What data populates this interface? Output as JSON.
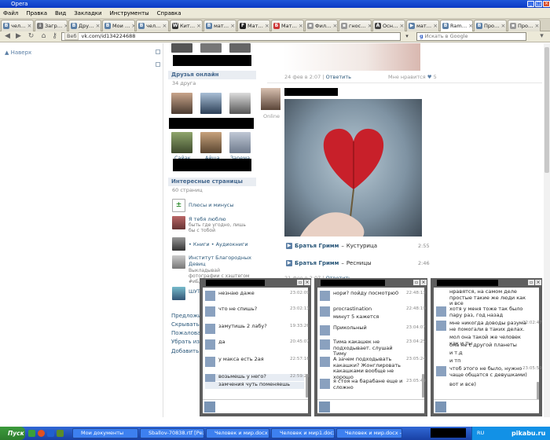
{
  "window": {
    "title": "Opera"
  },
  "menu": [
    "Файл",
    "Правка",
    "Вид",
    "Закладки",
    "Инструменты",
    "Справка"
  ],
  "tabs": [
    {
      "label": "чел…",
      "icon": "vk-icon",
      "color": "#5b7fa6"
    },
    {
      "label": "Загр…",
      "icon": "download-icon",
      "color": "#777777"
    },
    {
      "label": "Дру…",
      "icon": "vk-icon",
      "color": "#5b7fa6"
    },
    {
      "label": "Мои …",
      "icon": "vk-icon",
      "color": "#5b7fa6"
    },
    {
      "label": "чел…",
      "icon": "vk-icon",
      "color": "#5b7fa6"
    },
    {
      "label": "Кит…",
      "icon": "wikipedia-icon",
      "color": "#333333"
    },
    {
      "label": "мат…",
      "icon": "vk-icon",
      "color": "#5b7fa6"
    },
    {
      "label": "Мат…",
      "icon": "fb-icon",
      "color": "#222222"
    },
    {
      "label": "Мат…",
      "icon": "logo-icon",
      "color": "#cc3333"
    },
    {
      "label": "Фил…",
      "icon": "page-icon",
      "color": "#999999"
    },
    {
      "label": "гнос…",
      "icon": "page-icon",
      "color": "#999999"
    },
    {
      "label": "Осн…",
      "icon": "a-icon",
      "color": "#444444"
    },
    {
      "label": "мат…",
      "icon": "play-icon",
      "color": "#5b7fa6"
    },
    {
      "label": "Ram…",
      "icon": "vk-icon",
      "color": "#5b7fa6"
    },
    {
      "label": "Про…",
      "icon": "vk-icon",
      "color": "#5b7fa6"
    },
    {
      "label": "Про…",
      "icon": "page-icon",
      "color": "#999999"
    }
  ],
  "address": {
    "badge": "Веб",
    "url": "vk.com/id134224688",
    "search_placeholder": "Искать в Google"
  },
  "left": {
    "back": "Наверх"
  },
  "sidebar": {
    "friends_online_title": "Друзья онлайн",
    "friends_online_count": "34 друга",
    "friend_names": [
      "Сайак",
      "Айша",
      "Зарема"
    ],
    "pages_title": "Интересные страницы",
    "pages_count": "60 страниц",
    "pages": [
      {
        "name": "Плюсы и минусы",
        "desc": ""
      },
      {
        "name": "Я тебя люблю",
        "desc": "быть где угодно, лишь бы с тобой"
      },
      {
        "name": "• Книги • Аудиокниги",
        "desc": ""
      },
      {
        "name": "Институт Благородных Девиц",
        "desc": "Выкладывай фотографии с хэштегом #иБд . #bd - попадай в..."
      },
      {
        "name": "ШУТК…",
        "desc": ""
      }
    ],
    "links": [
      "Предложи…",
      "Скрывать но…",
      "Пожаловат…",
      "Убрать из др…",
      "Добавить в …"
    ]
  },
  "feed": {
    "post1": {
      "date": "24 фев в 2:07",
      "reply": "Ответить",
      "likes": "Мне нравится",
      "like_count": "5"
    },
    "post2": {
      "status": "Online"
    },
    "tracks": [
      {
        "artist": "Братья Гримм",
        "title": "Кустурица",
        "duration": "2:55"
      },
      {
        "artist": "Братья Гримм",
        "title": "Ресницы",
        "duration": "2:46"
      }
    ],
    "post3": {
      "date": "21 фев в 2:07",
      "reply": "Ответить"
    }
  },
  "chats": [
    {
      "messages": [
        {
          "text": "незнаю даже",
          "time": "23:02:09"
        },
        {
          "text": "что не спишь?",
          "time": "23:02:13"
        },
        {
          "text": "замутишь 2 лабу?",
          "time": "19:33:26"
        },
        {
          "text": "да",
          "time": "20:45:07"
        },
        {
          "text": "у макса есть 2ая",
          "time": "22:57:16"
        },
        {
          "text": "возьмешь у него?",
          "time": "22:59:28"
        },
        {
          "text": "замчения чуть поменяешь",
          "time": ""
        }
      ]
    },
    {
      "messages": [
        {
          "text": "нори? пойду посмотрю0",
          "time": "22:48:13"
        },
        {
          "text": "procrastination",
          "time": "22:48:19"
        },
        {
          "text": "минут 5 кажется",
          "time": ""
        },
        {
          "text": "Прикольный",
          "time": "23:04:07"
        },
        {
          "text": "Тима какашек не подходывает. слушай Тиму",
          "time": "23:04:25"
        },
        {
          "text": "А зачем подходывать какашки? Жонглировать какашками вообще не хорошо",
          "time": "23:05:24"
        },
        {
          "text": "я стоя на барабане еще и сложно",
          "time": "23:05:49"
        }
      ]
    },
    {
      "messages": [
        {
          "text": "нравятся, на самом деле простые такие же люди как и все",
          "time": ""
        },
        {
          "text": "хотя у меня тоже так было пару раз, год назад",
          "time": ""
        },
        {
          "text": "мне никогда доводы разума не помогали в таких делах.",
          "time": "22:02:47"
        },
        {
          "text": "мол она такой же человек как и ты",
          "time": ""
        },
        {
          "text": "она не с другой планеты",
          "time": ""
        },
        {
          "text": "и т.д",
          "time": ""
        },
        {
          "text": "и тп",
          "time": ""
        },
        {
          "text": "чтоб этого не было, нужно чаще общатся с девушками)",
          "time": "23:05:59"
        },
        {
          "text": "вот и все)",
          "time": ""
        }
      ]
    }
  ],
  "taskbar": {
    "start": "Пуск",
    "tasks": [
      "Мои документы",
      "Sballov-70838.rtf [Режи…",
      "Человек и мир.docx - Mi…",
      "Человек и мир1.docx - …",
      "Человек и мир.docx - Mi…"
    ],
    "tray_label": "RU",
    "watermark": "pikabu.ru"
  }
}
